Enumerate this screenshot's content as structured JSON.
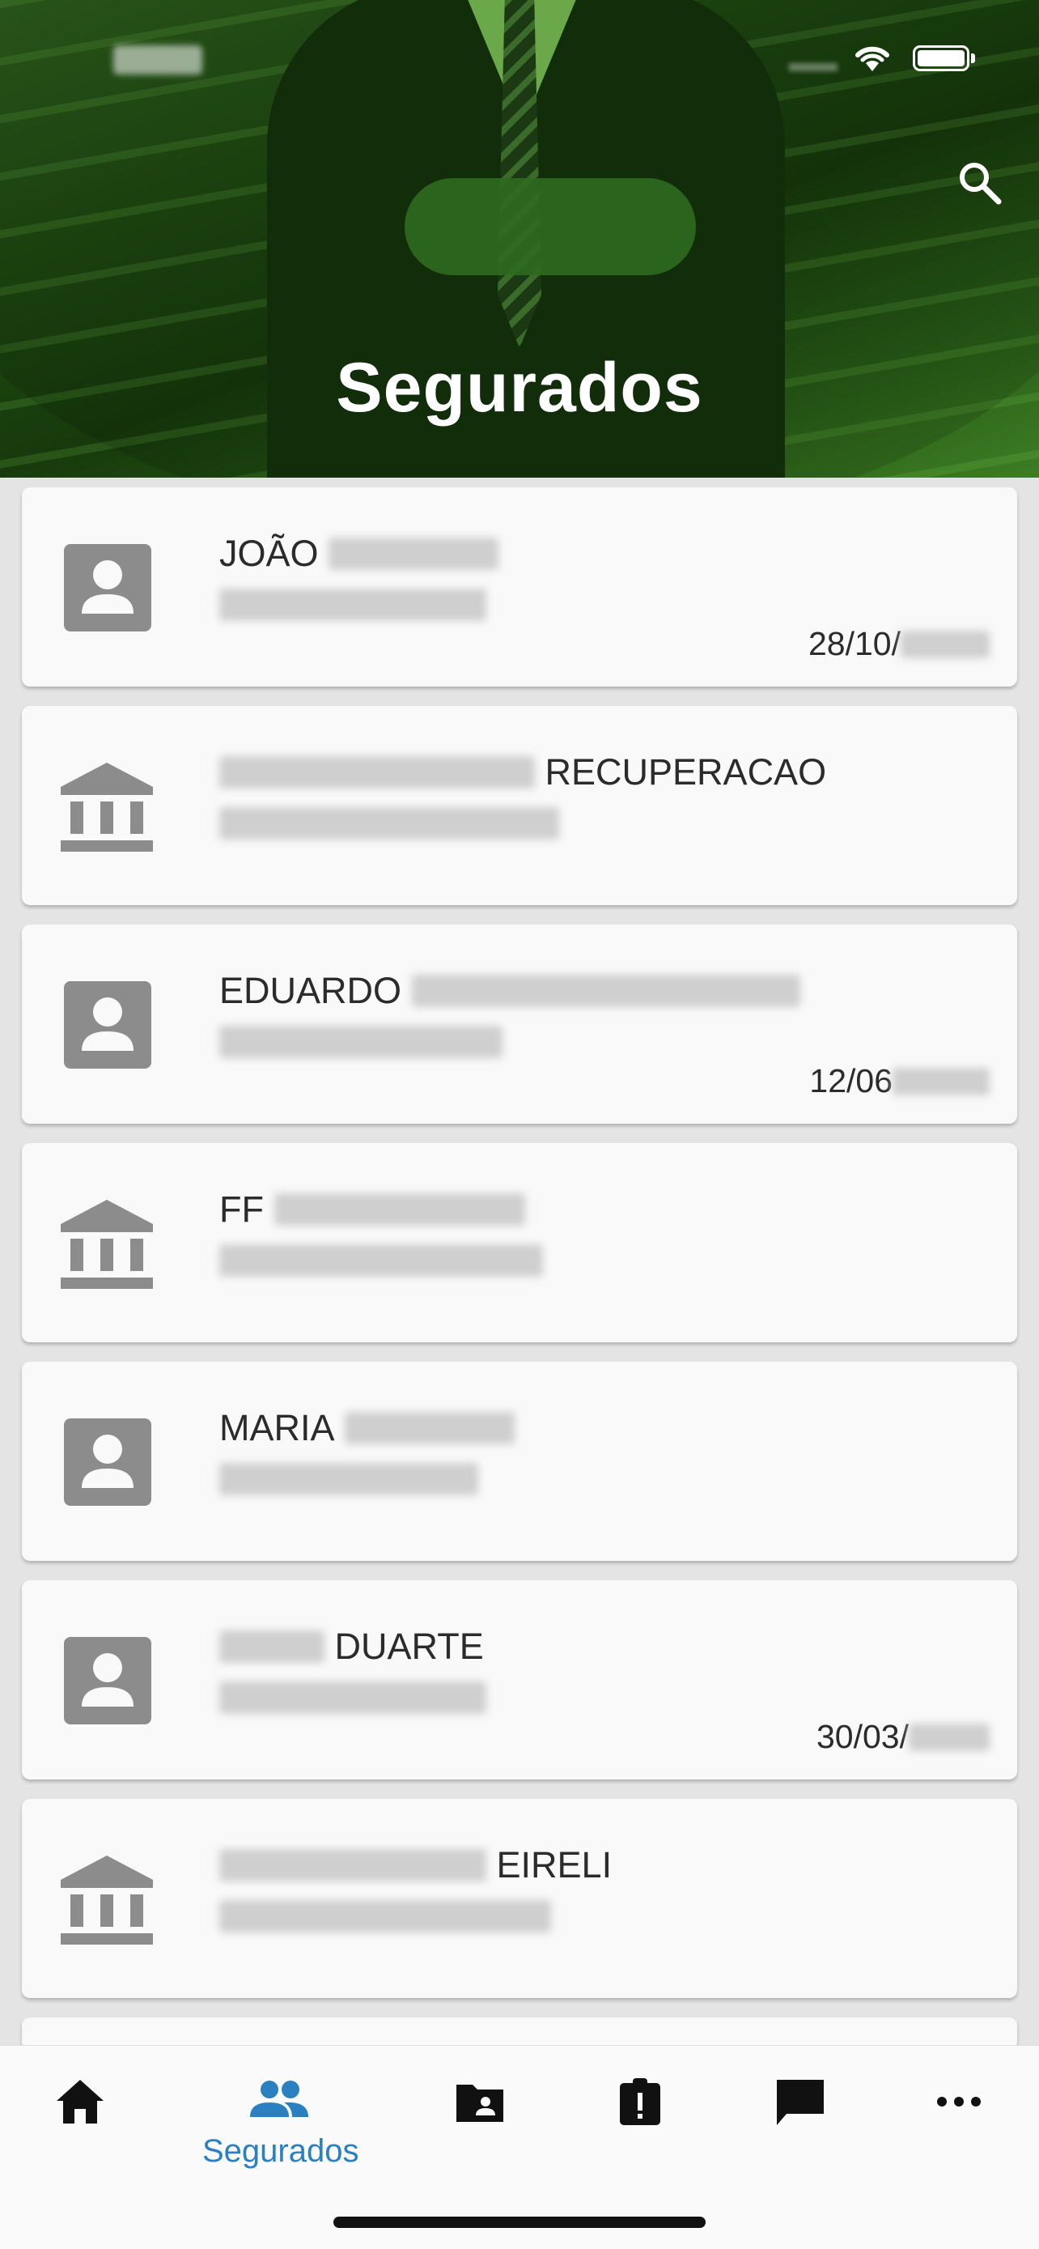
{
  "status_bar": {
    "wifi_icon": "wifi-icon",
    "battery_icon": "battery-icon"
  },
  "header": {
    "title": "Segurados",
    "search_icon": "search-icon"
  },
  "insured": [
    {
      "type": "person",
      "icon": "contact-card-icon",
      "name": "JOÃO",
      "date": "28/10/"
    },
    {
      "type": "company",
      "icon": "bank-icon",
      "name": "RECUPERACAO",
      "date": ""
    },
    {
      "type": "person",
      "icon": "contact-card-icon",
      "name": "EDUARDO",
      "date": "12/06"
    },
    {
      "type": "company",
      "icon": "bank-icon",
      "name": "FF",
      "date": ""
    },
    {
      "type": "person",
      "icon": "contact-card-icon",
      "name": "MARIA",
      "date": ""
    },
    {
      "type": "person",
      "icon": "contact-card-icon",
      "name": "DUARTE",
      "date": "30/03/"
    },
    {
      "type": "company",
      "icon": "bank-icon",
      "name": "EIRELI",
      "date": ""
    }
  ],
  "bottom_nav": {
    "active_label": "Segurados",
    "items": [
      {
        "icon": "home-icon"
      },
      {
        "icon": "people-icon",
        "label": "Segurados"
      },
      {
        "icon": "folder-account-icon"
      },
      {
        "icon": "clipboard-alert-icon"
      },
      {
        "icon": "chat-icon"
      },
      {
        "icon": "more-icon"
      }
    ]
  },
  "colors": {
    "accent": "#2a80c0",
    "header_green": "#1f4a12",
    "icon_gray": "#8c8c8c"
  }
}
